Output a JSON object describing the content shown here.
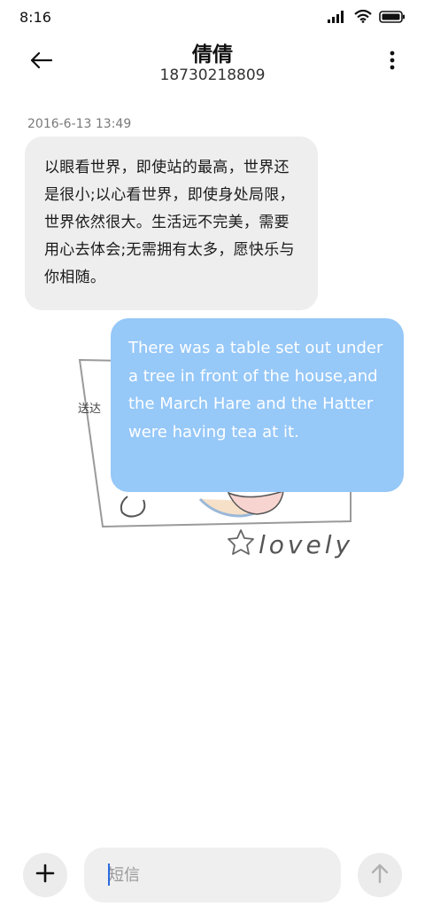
{
  "status_bar": {
    "time": "8:16",
    "icons": [
      "signal-icon",
      "wifi-icon",
      "battery-icon"
    ]
  },
  "header": {
    "contact_name": "倩倩",
    "contact_number": "18730218809",
    "back_icon": "back-arrow-icon",
    "menu_icon": "more-vertical-icon"
  },
  "conversation": {
    "timestamp": "2016-6-13 13:49",
    "incoming_message": "以眼看世界，即使站的最高，世界还是很小;以心看世界，即使身处局限，世界依然很大。生活远不完美，需要用心去体会;无需拥有太多，愿快乐与你相随。",
    "outgoing_message": "There was a table set out under a tree in front of the house,and the March Hare and the Hatter were having tea at it.",
    "delivery_status": "送达",
    "sticker_text": "lovely"
  },
  "compose": {
    "placeholder": "短信",
    "add_icon": "plus-icon",
    "send_icon": "send-arrow-up-icon"
  },
  "colors": {
    "incoming_bubble": "#eeeeee",
    "outgoing_bubble": "#96c8f8",
    "caret": "#2a6ae0"
  }
}
